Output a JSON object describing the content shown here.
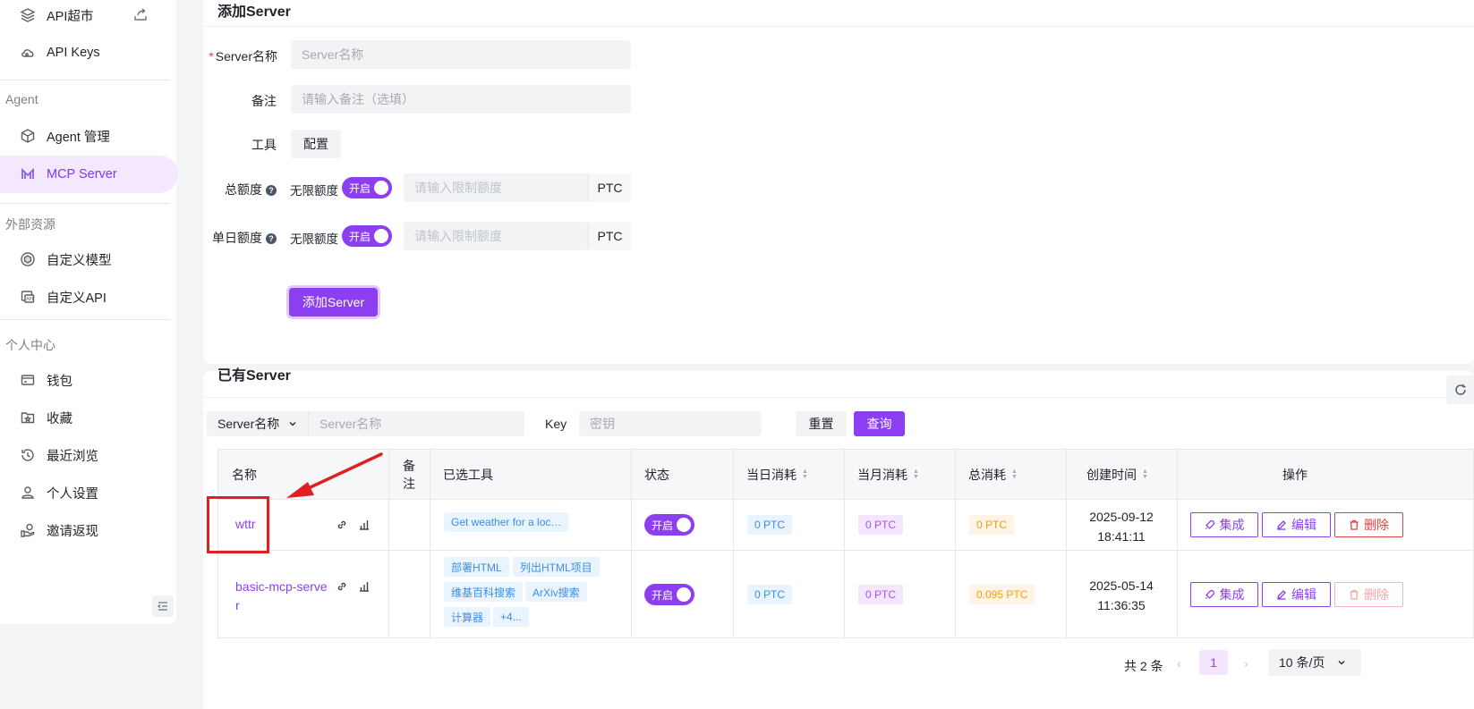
{
  "sidebar": {
    "items": [
      {
        "label": "API超市",
        "icon": "layers-icon"
      },
      {
        "label": "API Keys",
        "icon": "cloud-key-icon"
      },
      {
        "label": "Agent 管理",
        "icon": "cube-icon"
      },
      {
        "label": "MCP Server",
        "icon": "mcp-logo-icon"
      },
      {
        "label": "自定义模型",
        "icon": "model-icon"
      },
      {
        "label": "自定义API",
        "icon": "api-icon"
      },
      {
        "label": "钱包",
        "icon": "wallet-icon"
      },
      {
        "label": "收藏",
        "icon": "star-folder-icon"
      },
      {
        "label": "最近浏览",
        "icon": "history-icon"
      },
      {
        "label": "个人设置",
        "icon": "user-icon"
      },
      {
        "label": "邀请返现",
        "icon": "invite-cashback-icon"
      }
    ],
    "sections": [
      "Agent",
      "外部资源",
      "个人中心"
    ],
    "active": "MCP Server"
  },
  "add_server": {
    "title": "添加Server",
    "name_label": "Server名称",
    "name_placeholder": "Server名称",
    "note_label": "备注",
    "note_placeholder": "请输入备注（选填）",
    "tools_label": "工具",
    "tools_button": "配置",
    "total_quota_label": "总额度",
    "daily_quota_label": "单日额度",
    "unlimited_label": "无限额度",
    "switch_on": "开启",
    "quota_placeholder": "请输入限制额度",
    "unit": "PTC",
    "submit": "添加Server"
  },
  "list": {
    "title": "已有Server",
    "filter_select": "Server名称",
    "filter_placeholder": "Server名称",
    "key_label": "Key",
    "key_placeholder": "密钥",
    "reset": "重置",
    "query": "查询",
    "columns": [
      "名称",
      "备注",
      "已选工具",
      "状态",
      "当日消耗",
      "当月消耗",
      "总消耗",
      "创建时间",
      "操作"
    ],
    "rows": [
      {
        "name": "wttr",
        "note": "",
        "tools": [
          "Get weather for a loc…"
        ],
        "status": "开启",
        "daily": "0 PTC",
        "monthly": "0 PTC",
        "total": "0 PTC",
        "date": "2025-09-12",
        "time": "18:41:11"
      },
      {
        "name_line1": "basic-mcp-serve",
        "name_line2": "r",
        "note": "",
        "tools": [
          "部署HTML",
          "列出HTML项目",
          "维基百科搜索",
          "ArXiv搜索",
          "计算器",
          "+4..."
        ],
        "status": "开启",
        "daily": "0 PTC",
        "monthly": "0 PTC",
        "total": "0.095 PTC",
        "date": "2025-05-14",
        "time": "11:36:35"
      }
    ],
    "actions": {
      "integrate": "集成",
      "edit": "编辑",
      "delete": "删除"
    },
    "pagination": {
      "total": "共 2 条",
      "page": "1",
      "size": "10 条/页"
    }
  }
}
